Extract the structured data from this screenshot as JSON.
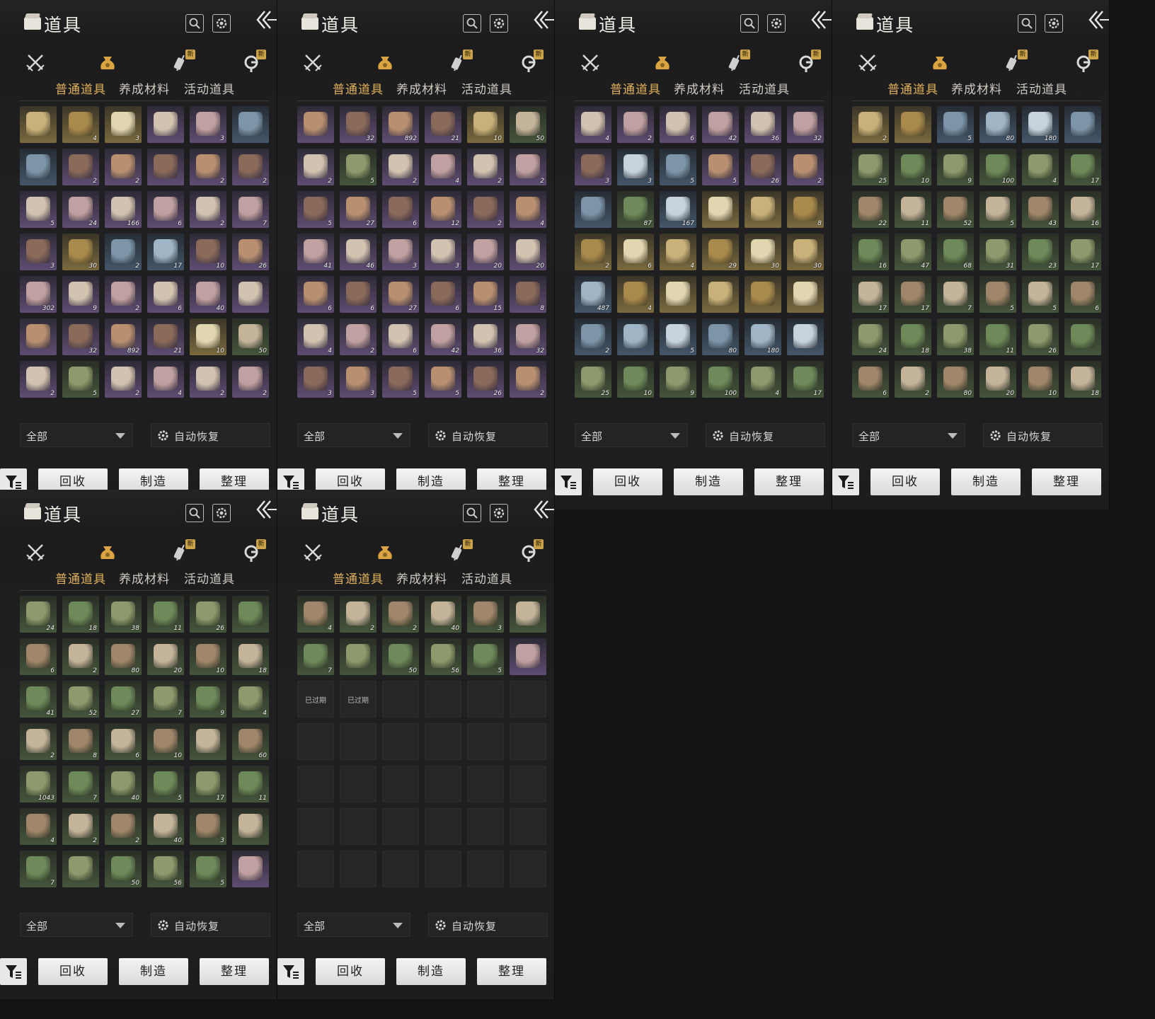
{
  "title": "道具",
  "header_icons": [
    "search-icon",
    "gear-icon",
    "close-arrow-icon"
  ],
  "category_icons": [
    "crossed-swords-icon",
    "coin-pouch-icon",
    "scroll-pen-icon",
    "hook-icon"
  ],
  "new_badge": "新",
  "tabs": [
    "普通道具",
    "养成材料",
    "活动道具"
  ],
  "active_tab": "普通道具",
  "filter_value": "全部",
  "auto_restore_label": "自动恢复",
  "buttons": {
    "recycle": "回收",
    "craft": "制造",
    "sort": "整理"
  },
  "expired_label": "已过期",
  "accent_color": "#e0b15a",
  "panels": [
    {
      "rows": [
        [
          [
            "gold",
            ""
          ],
          [
            "gold",
            "4"
          ],
          [
            "gold",
            "3"
          ],
          [
            "purple",
            ""
          ],
          [
            "purple",
            "3"
          ],
          [
            "blue",
            ""
          ]
        ],
        [
          [
            "blue",
            ""
          ],
          [
            "purple",
            "2"
          ],
          [
            "purple",
            "2"
          ],
          [
            "purple",
            ""
          ],
          [
            "purple",
            "2"
          ],
          [
            "purple",
            "2"
          ]
        ],
        [
          [
            "purple",
            "5"
          ],
          [
            "purple",
            "24"
          ],
          [
            "purple",
            "166"
          ],
          [
            "purple",
            "6"
          ],
          [
            "purple",
            "2"
          ],
          [
            "purple",
            "7"
          ]
        ],
        [
          [
            "purple",
            "3"
          ],
          [
            "gold",
            "30"
          ],
          [
            "blue",
            "2"
          ],
          [
            "blue",
            "17"
          ],
          [
            "purple",
            "10"
          ],
          [
            "purple",
            "26"
          ]
        ],
        [
          [
            "purple",
            "302"
          ],
          [
            "purple",
            "9"
          ],
          [
            "purple",
            "2"
          ],
          [
            "purple",
            "6"
          ],
          [
            "purple",
            "40"
          ],
          [
            "purple",
            ""
          ]
        ],
        [
          [
            "purple",
            ""
          ],
          [
            "purple",
            "32"
          ],
          [
            "purple",
            "892"
          ],
          [
            "purple",
            "21"
          ],
          [
            "gold",
            "10"
          ],
          [
            "green",
            "50"
          ]
        ],
        [
          [
            "purple",
            "2"
          ],
          [
            "green",
            "5"
          ],
          [
            "purple",
            "2"
          ],
          [
            "purple",
            "4"
          ],
          [
            "purple",
            "2"
          ],
          [
            "purple",
            "2"
          ]
        ]
      ]
    },
    {
      "rows": [
        [
          [
            "purple",
            ""
          ],
          [
            "purple",
            "32"
          ],
          [
            "purple",
            "892"
          ],
          [
            "purple",
            "21"
          ],
          [
            "gold",
            "10"
          ],
          [
            "green",
            "50"
          ]
        ],
        [
          [
            "purple",
            "2"
          ],
          [
            "green",
            "5"
          ],
          [
            "purple",
            "2"
          ],
          [
            "purple",
            "4"
          ],
          [
            "purple",
            "2"
          ],
          [
            "purple",
            "2"
          ]
        ],
        [
          [
            "purple",
            "5"
          ],
          [
            "purple",
            "27"
          ],
          [
            "purple",
            "6"
          ],
          [
            "purple",
            "12"
          ],
          [
            "purple",
            "2"
          ],
          [
            "purple",
            "4"
          ]
        ],
        [
          [
            "purple",
            "41"
          ],
          [
            "purple",
            "46"
          ],
          [
            "purple",
            "3"
          ],
          [
            "purple",
            "3"
          ],
          [
            "purple",
            "20"
          ],
          [
            "purple",
            "20"
          ]
        ],
        [
          [
            "purple",
            "6"
          ],
          [
            "purple",
            "6"
          ],
          [
            "purple",
            "27"
          ],
          [
            "purple",
            "6"
          ],
          [
            "purple",
            "15"
          ],
          [
            "purple",
            "8"
          ]
        ],
        [
          [
            "purple",
            "4"
          ],
          [
            "purple",
            "2"
          ],
          [
            "purple",
            "6"
          ],
          [
            "purple",
            "42"
          ],
          [
            "purple",
            "36"
          ],
          [
            "purple",
            "32"
          ]
        ],
        [
          [
            "purple",
            "3"
          ],
          [
            "purple",
            "3"
          ],
          [
            "purple",
            "5"
          ],
          [
            "purple",
            "5"
          ],
          [
            "purple",
            "26"
          ],
          [
            "purple",
            "2"
          ]
        ]
      ]
    },
    {
      "rows": [
        [
          [
            "purple",
            "4"
          ],
          [
            "purple",
            "2"
          ],
          [
            "purple",
            "6"
          ],
          [
            "purple",
            "42"
          ],
          [
            "purple",
            "36"
          ],
          [
            "purple",
            "32"
          ]
        ],
        [
          [
            "purple",
            "3"
          ],
          [
            "blue",
            "3"
          ],
          [
            "blue",
            "5"
          ],
          [
            "purple",
            "5"
          ],
          [
            "purple",
            "26"
          ],
          [
            "purple",
            "2"
          ]
        ],
        [
          [
            "blue",
            ""
          ],
          [
            "green",
            "87"
          ],
          [
            "blue",
            "167"
          ],
          [
            "gold",
            ""
          ],
          [
            "gold",
            ""
          ],
          [
            "gold",
            "8"
          ]
        ],
        [
          [
            "gold",
            "2"
          ],
          [
            "gold",
            "6"
          ],
          [
            "gold",
            "4"
          ],
          [
            "gold",
            "29"
          ],
          [
            "gold",
            "30"
          ],
          [
            "gold",
            "30"
          ]
        ],
        [
          [
            "blue",
            "487"
          ],
          [
            "gold",
            "4"
          ],
          [
            "gold",
            ""
          ],
          [
            "gold",
            ""
          ],
          [
            "gold",
            ""
          ],
          [
            "gold",
            ""
          ]
        ],
        [
          [
            "blue",
            "2"
          ],
          [
            "blue",
            ""
          ],
          [
            "blue",
            "5"
          ],
          [
            "blue",
            "80"
          ],
          [
            "blue",
            "180"
          ],
          [
            "blue",
            ""
          ]
        ],
        [
          [
            "green",
            "25"
          ],
          [
            "green",
            "10"
          ],
          [
            "green",
            "9"
          ],
          [
            "green",
            "100"
          ],
          [
            "green",
            "4"
          ],
          [
            "green",
            "17"
          ]
        ]
      ]
    },
    {
      "rows": [
        [
          [
            "gold",
            "2"
          ],
          [
            "gold",
            ""
          ],
          [
            "blue",
            "5"
          ],
          [
            "blue",
            "80"
          ],
          [
            "blue",
            "180"
          ],
          [
            "blue",
            ""
          ]
        ],
        [
          [
            "green",
            "25"
          ],
          [
            "green",
            "10"
          ],
          [
            "green",
            "9"
          ],
          [
            "green",
            "100"
          ],
          [
            "green",
            "4"
          ],
          [
            "green",
            "17"
          ]
        ],
        [
          [
            "green",
            "22"
          ],
          [
            "green",
            "11"
          ],
          [
            "green",
            "52"
          ],
          [
            "green",
            "5"
          ],
          [
            "green",
            "43"
          ],
          [
            "green",
            "16"
          ]
        ],
        [
          [
            "green",
            "16"
          ],
          [
            "green",
            "47"
          ],
          [
            "green",
            "68"
          ],
          [
            "green",
            "31"
          ],
          [
            "green",
            "23"
          ],
          [
            "green",
            "17"
          ]
        ],
        [
          [
            "green",
            "17"
          ],
          [
            "green",
            "17"
          ],
          [
            "green",
            "7"
          ],
          [
            "green",
            "5"
          ],
          [
            "green",
            "5"
          ],
          [
            "green",
            "6"
          ]
        ],
        [
          [
            "green",
            "24"
          ],
          [
            "green",
            "18"
          ],
          [
            "green",
            "38"
          ],
          [
            "green",
            "11"
          ],
          [
            "green",
            "26"
          ],
          [
            "green",
            ""
          ]
        ],
        [
          [
            "green",
            "6"
          ],
          [
            "green",
            "2"
          ],
          [
            "green",
            "80"
          ],
          [
            "green",
            "20"
          ],
          [
            "green",
            "10"
          ],
          [
            "green",
            "18"
          ]
        ]
      ]
    },
    {
      "rows": [
        [
          [
            "green",
            "24"
          ],
          [
            "green",
            "18"
          ],
          [
            "green",
            "38"
          ],
          [
            "green",
            "11"
          ],
          [
            "green",
            "26"
          ],
          [
            "green",
            ""
          ]
        ],
        [
          [
            "green",
            "6"
          ],
          [
            "green",
            "2"
          ],
          [
            "green",
            "80"
          ],
          [
            "green",
            "20"
          ],
          [
            "green",
            "10"
          ],
          [
            "green",
            "18"
          ]
        ],
        [
          [
            "green",
            "41"
          ],
          [
            "green",
            "52"
          ],
          [
            "green",
            "27"
          ],
          [
            "green",
            "7"
          ],
          [
            "green",
            "9"
          ],
          [
            "green",
            "4"
          ]
        ],
        [
          [
            "green",
            "2"
          ],
          [
            "green",
            "8"
          ],
          [
            "green",
            "6"
          ],
          [
            "green",
            "10"
          ],
          [
            "green",
            ""
          ],
          [
            "green",
            "60"
          ]
        ],
        [
          [
            "green",
            "1043"
          ],
          [
            "green",
            "7"
          ],
          [
            "green",
            "40"
          ],
          [
            "green",
            "5"
          ],
          [
            "green",
            "17"
          ],
          [
            "green",
            "11"
          ]
        ],
        [
          [
            "green",
            "4"
          ],
          [
            "green",
            "2"
          ],
          [
            "green",
            "2"
          ],
          [
            "green",
            "40"
          ],
          [
            "green",
            "3"
          ],
          [
            "green",
            ""
          ]
        ],
        [
          [
            "green",
            "7"
          ],
          [
            "green",
            ""
          ],
          [
            "green",
            "50"
          ],
          [
            "green",
            "56"
          ],
          [
            "green",
            "5"
          ],
          [
            "purple",
            ""
          ]
        ]
      ]
    },
    {
      "rows": [
        [
          [
            "green",
            "4"
          ],
          [
            "green",
            "2"
          ],
          [
            "green",
            "2"
          ],
          [
            "green",
            "40"
          ],
          [
            "green",
            "3"
          ],
          [
            "green",
            ""
          ]
        ],
        [
          [
            "green",
            "7"
          ],
          [
            "green",
            ""
          ],
          [
            "green",
            "50"
          ],
          [
            "green",
            "56"
          ],
          [
            "green",
            "5"
          ],
          [
            "purple",
            ""
          ]
        ],
        [
          [
            "expired",
            ""
          ],
          [
            "expired",
            ""
          ],
          [
            "empty",
            ""
          ],
          [
            "empty",
            ""
          ],
          [
            "empty",
            ""
          ],
          [
            "empty",
            ""
          ]
        ],
        [
          [
            "empty",
            ""
          ],
          [
            "empty",
            ""
          ],
          [
            "empty",
            ""
          ],
          [
            "empty",
            ""
          ],
          [
            "empty",
            ""
          ],
          [
            "empty",
            ""
          ]
        ],
        [
          [
            "empty",
            ""
          ],
          [
            "empty",
            ""
          ],
          [
            "empty",
            ""
          ],
          [
            "empty",
            ""
          ],
          [
            "empty",
            ""
          ],
          [
            "empty",
            ""
          ]
        ],
        [
          [
            "empty",
            ""
          ],
          [
            "empty",
            ""
          ],
          [
            "empty",
            ""
          ],
          [
            "empty",
            ""
          ],
          [
            "empty",
            ""
          ],
          [
            "empty",
            ""
          ]
        ],
        [
          [
            "empty",
            ""
          ],
          [
            "empty",
            ""
          ],
          [
            "empty",
            ""
          ],
          [
            "empty",
            ""
          ],
          [
            "empty",
            ""
          ],
          [
            "empty",
            ""
          ]
        ]
      ]
    }
  ]
}
